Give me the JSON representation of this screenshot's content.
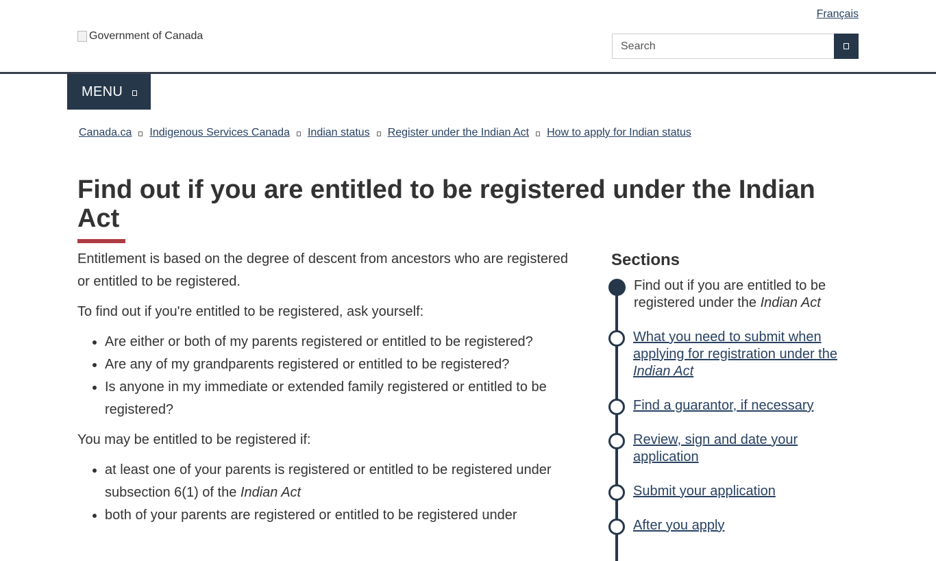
{
  "header": {
    "language_link": "Français",
    "logo_alt": "Government of Canada",
    "search_placeholder": "Search",
    "search_button_icon": "search-icon",
    "menu_label": "MENU",
    "menu_icon": "chevron-down-icon"
  },
  "breadcrumb": [
    "Canada.ca",
    "Indigenous Services Canada",
    "Indian status",
    "Register under the Indian Act",
    "How to apply for Indian status"
  ],
  "page": {
    "title": "Find out if you are entitled to be registered under the Indian Act"
  },
  "main": {
    "intro": "Entitlement is based on the degree of descent from ancestors who are registered or entitled to be registered.",
    "ask_intro": "To find out if you're entitled to be registered, ask yourself:",
    "questions": [
      "Are either or both of my parents registered or entitled to be registered?",
      "Are any of my grandparents registered or entitled to be registered?",
      "Is anyone in my immediate or extended family registered or entitled to be registered?"
    ],
    "may_be_entitled": "You may be entitled to be registered if:",
    "conditions": [
      {
        "text": "at least one of your parents is registered or entitled to be registered under subsection 6(1) of the ",
        "emphasis": "Indian Act"
      },
      {
        "text": "both of your parents are registered or entitled to be registered under",
        "emphasis": ""
      }
    ]
  },
  "sections": {
    "heading": "Sections",
    "steps": [
      {
        "text": "Find out if you are entitled to be registered under the ",
        "emphasis": "Indian Act",
        "current": true
      },
      {
        "text": "What you need to submit when applying for registration under the ",
        "emphasis": "Indian Act",
        "current": false
      },
      {
        "text": "Find a guarantor, if necessary",
        "emphasis": "",
        "current": false
      },
      {
        "text": "Review, sign and date your application",
        "emphasis": "",
        "current": false
      },
      {
        "text": "Submit your application",
        "emphasis": "",
        "current": false
      },
      {
        "text": "After you apply",
        "emphasis": "",
        "current": false
      }
    ]
  },
  "colors": {
    "header_blue": "#26374a",
    "link": "#284162",
    "title_accent": "#af3c43",
    "text": "#333333"
  }
}
